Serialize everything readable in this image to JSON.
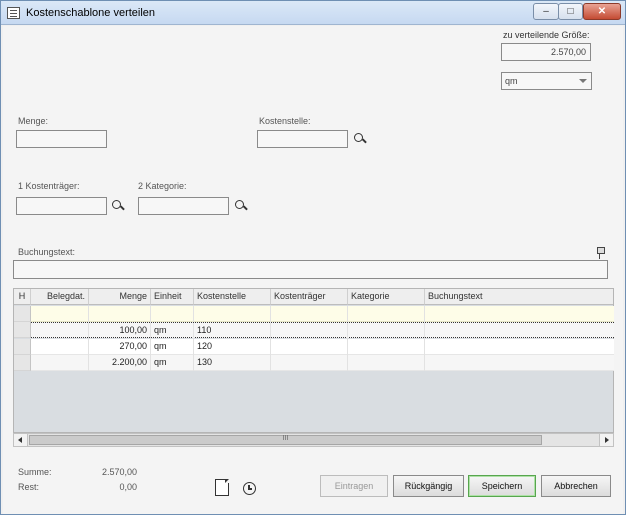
{
  "window": {
    "title": "Kostenschablone verteilen",
    "controls": {
      "min": "–",
      "max": "□",
      "close": "✕"
    }
  },
  "top_right": {
    "groesse_label": "zu verteilende Größe:",
    "groesse_value": "2.570,00",
    "unit_select": "qm"
  },
  "form": {
    "menge_label": "Menge:",
    "menge_value": "",
    "kostenstelle_label": "Kostenstelle:",
    "kostenstelle_value": "",
    "kostentraeger_label": "1 Kostenträger:",
    "kostentraeger_value": "",
    "kategorie_label": "2 Kategorie:",
    "kategorie_value": "",
    "buchungstext_label": "Buchungstext:",
    "buchungstext_value": ""
  },
  "grid": {
    "columns": [
      "H",
      "Belegdat.",
      "Menge",
      "Einheit",
      "Kostenstelle",
      "Kostenträger",
      "Kategorie",
      "Buchungstext"
    ],
    "rows": [
      {
        "belegdat": "",
        "menge": "",
        "einheit": "",
        "kostenstelle": "",
        "kostentraeger": "",
        "kategorie": "",
        "buchungstext": ""
      },
      {
        "belegdat": "",
        "menge": "100,00",
        "einheit": "qm",
        "kostenstelle": "110",
        "kostentraeger": "",
        "kategorie": "",
        "buchungstext": ""
      },
      {
        "belegdat": "",
        "menge": "270,00",
        "einheit": "qm",
        "kostenstelle": "120",
        "kostentraeger": "",
        "kategorie": "",
        "buchungstext": ""
      },
      {
        "belegdat": "",
        "menge": "2.200,00",
        "einheit": "qm",
        "kostenstelle": "130",
        "kostentraeger": "",
        "kategorie": "",
        "buchungstext": ""
      }
    ],
    "scroll_thumb": "III"
  },
  "summary": {
    "summe_label": "Summe:",
    "summe_value": "2.570,00",
    "rest_label": "Rest:",
    "rest_value": "0,00"
  },
  "buttons": {
    "eintragen": "Eintragen",
    "rueckgaengig": "Rückgängig",
    "speichern": "Speichern",
    "abbrechen": "Abbrechen"
  },
  "colors": {
    "highlight_row": "#fefde8",
    "primary_border": "#58a54f"
  }
}
